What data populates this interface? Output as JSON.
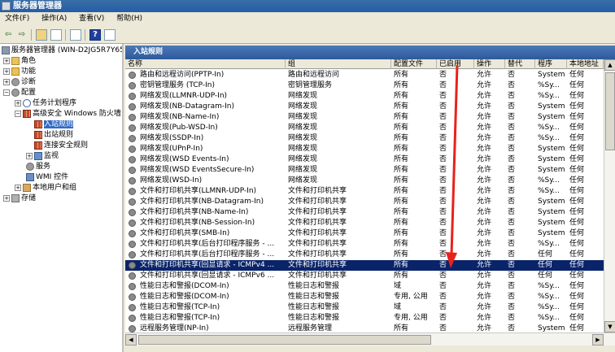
{
  "window": {
    "title": "服务器管理器"
  },
  "menu": [
    "文件(F)",
    "操作(A)",
    "查看(V)",
    "帮助(H)"
  ],
  "toolbar": {
    "back": "⇦",
    "forward": "⇨",
    "help": "?"
  },
  "tree": {
    "root": "服务器管理器 (WIN-D2JG5R7Y657)",
    "nodes": {
      "roles": "角色",
      "features": "功能",
      "diagnostics": "诊断",
      "configuration": "配置",
      "task_scheduler": "任务计划程序",
      "firewall": "高级安全 Windows 防火墙",
      "inbound": "入站规则",
      "outbound": "出站规则",
      "connection_security": "连接安全规则",
      "monitoring": "监视",
      "services": "服务",
      "wmi": "WMI 控件",
      "local_users": "本地用户和组",
      "storage": "存储"
    }
  },
  "panel": {
    "title": "入站规则"
  },
  "columns": [
    "名称",
    "组",
    "配置文件",
    "已启用",
    "操作",
    "替代",
    "程序",
    "本地地址"
  ],
  "rows": [
    {
      "name": "路由和远程访问(PPTP-In)",
      "group": "路由和远程访问",
      "profile": "所有",
      "enabled": "否",
      "action": "允许",
      "override": "否",
      "program": "System",
      "local": "任何"
    },
    {
      "name": "密钥管理服务 (TCP-In)",
      "group": "密钥管理服务",
      "profile": "所有",
      "enabled": "否",
      "action": "允许",
      "override": "否",
      "program": "%Sy...",
      "local": "任何"
    },
    {
      "name": "网络发现(LLMNR-UDP-In)",
      "group": "网络发现",
      "profile": "所有",
      "enabled": "否",
      "action": "允许",
      "override": "否",
      "program": "%Sy...",
      "local": "任何"
    },
    {
      "name": "网络发现(NB-Datagram-In)",
      "group": "网络发现",
      "profile": "所有",
      "enabled": "否",
      "action": "允许",
      "override": "否",
      "program": "System",
      "local": "任何"
    },
    {
      "name": "网络发现(NB-Name-In)",
      "group": "网络发现",
      "profile": "所有",
      "enabled": "否",
      "action": "允许",
      "override": "否",
      "program": "System",
      "local": "任何"
    },
    {
      "name": "网络发现(Pub-WSD-In)",
      "group": "网络发现",
      "profile": "所有",
      "enabled": "否",
      "action": "允许",
      "override": "否",
      "program": "%Sy...",
      "local": "任何"
    },
    {
      "name": "网络发现(SSDP-In)",
      "group": "网络发现",
      "profile": "所有",
      "enabled": "否",
      "action": "允许",
      "override": "否",
      "program": "%Sy...",
      "local": "任何"
    },
    {
      "name": "网络发现(UPnP-In)",
      "group": "网络发现",
      "profile": "所有",
      "enabled": "否",
      "action": "允许",
      "override": "否",
      "program": "System",
      "local": "任何"
    },
    {
      "name": "网络发现(WSD Events-In)",
      "group": "网络发现",
      "profile": "所有",
      "enabled": "否",
      "action": "允许",
      "override": "否",
      "program": "System",
      "local": "任何"
    },
    {
      "name": "网络发现(WSD EventsSecure-In)",
      "group": "网络发现",
      "profile": "所有",
      "enabled": "否",
      "action": "允许",
      "override": "否",
      "program": "System",
      "local": "任何"
    },
    {
      "name": "网络发现(WSD-In)",
      "group": "网络发现",
      "profile": "所有",
      "enabled": "否",
      "action": "允许",
      "override": "否",
      "program": "%Sy...",
      "local": "任何"
    },
    {
      "name": "文件和打印机共享(LLMNR-UDP-In)",
      "group": "文件和打印机共享",
      "profile": "所有",
      "enabled": "否",
      "action": "允许",
      "override": "否",
      "program": "%Sy...",
      "local": "任何"
    },
    {
      "name": "文件和打印机共享(NB-Datagram-In)",
      "group": "文件和打印机共享",
      "profile": "所有",
      "enabled": "否",
      "action": "允许",
      "override": "否",
      "program": "System",
      "local": "任何"
    },
    {
      "name": "文件和打印机共享(NB-Name-In)",
      "group": "文件和打印机共享",
      "profile": "所有",
      "enabled": "否",
      "action": "允许",
      "override": "否",
      "program": "System",
      "local": "任何"
    },
    {
      "name": "文件和打印机共享(NB-Session-In)",
      "group": "文件和打印机共享",
      "profile": "所有",
      "enabled": "否",
      "action": "允许",
      "override": "否",
      "program": "System",
      "local": "任何"
    },
    {
      "name": "文件和打印机共享(SMB-In)",
      "group": "文件和打印机共享",
      "profile": "所有",
      "enabled": "否",
      "action": "允许",
      "override": "否",
      "program": "System",
      "local": "任何"
    },
    {
      "name": "文件和打印机共享(后台打印程序服务 - ...",
      "group": "文件和打印机共享",
      "profile": "所有",
      "enabled": "否",
      "action": "允许",
      "override": "否",
      "program": "%Sy...",
      "local": "任何"
    },
    {
      "name": "文件和打印机共享(后台打印程序服务 - ...",
      "group": "文件和打印机共享",
      "profile": "所有",
      "enabled": "否",
      "action": "允许",
      "override": "否",
      "program": "任何",
      "local": "任何"
    },
    {
      "name": "文件和打印机共享(回显请求 - ICMPv4 ...",
      "group": "文件和打印机共享",
      "profile": "所有",
      "enabled": "否",
      "action": "允许",
      "override": "否",
      "program": "任何",
      "local": "任何",
      "selected": true
    },
    {
      "name": "文件和打印机共享(回显请求 - ICMPv6 ...",
      "group": "文件和打印机共享",
      "profile": "所有",
      "enabled": "否",
      "action": "允许",
      "override": "否",
      "program": "任何",
      "local": "任何"
    },
    {
      "name": "性能日志和警报(DCOM-In)",
      "group": "性能日志和警报",
      "profile": "域",
      "enabled": "否",
      "action": "允许",
      "override": "否",
      "program": "%Sy...",
      "local": "任何"
    },
    {
      "name": "性能日志和警报(DCOM-In)",
      "group": "性能日志和警报",
      "profile": "专用, 公用",
      "enabled": "否",
      "action": "允许",
      "override": "否",
      "program": "%Sy...",
      "local": "任何"
    },
    {
      "name": "性能日志和警报(TCP-In)",
      "group": "性能日志和警报",
      "profile": "域",
      "enabled": "否",
      "action": "允许",
      "override": "否",
      "program": "%Sy...",
      "local": "任何"
    },
    {
      "name": "性能日志和警报(TCP-In)",
      "group": "性能日志和警报",
      "profile": "专用, 公用",
      "enabled": "否",
      "action": "允许",
      "override": "否",
      "program": "%Sy...",
      "local": "任何"
    },
    {
      "name": "远程服务管理(NP-In)",
      "group": "远程服务管理",
      "profile": "所有",
      "enabled": "否",
      "action": "允许",
      "override": "否",
      "program": "System",
      "local": "任何"
    }
  ],
  "colors": {
    "selection": "#0a246a",
    "header": "#2e5a9a",
    "arrow": "#e8221a"
  }
}
